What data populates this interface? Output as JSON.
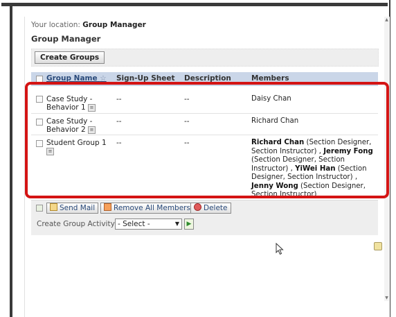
{
  "breadcrumb": {
    "label": "Your location:",
    "current": "Group Manager"
  },
  "page_title": "Group Manager",
  "toolbar": {
    "create_groups_label": "Create Groups"
  },
  "table": {
    "headers": {
      "group_name": "Group Name",
      "signup_sheet": "Sign-Up Sheet",
      "description": "Description",
      "members": "Members"
    },
    "rows": [
      {
        "name_line1": "Case Study -",
        "name_line2": "Behavior 1",
        "signup": "--",
        "description": "--",
        "members_text": "Daisy Chan"
      },
      {
        "name_line1": "Case Study -",
        "name_line2": "Behavior 2",
        "signup": "--",
        "description": "--",
        "members_text": "Richard Chan"
      },
      {
        "name_line1": "Student Group 1",
        "signup": "--",
        "description": "--",
        "members": [
          {
            "name": "Richard Chan",
            "roles": " (Section Designer, Section Instructor) ,"
          },
          {
            "name": "Jeremy Fong",
            "roles": " (Section Designer, Section Instructor) ,"
          },
          {
            "name": "YiWei Han",
            "roles": " (Section Designer, Section Instructor) ,"
          },
          {
            "name": "Jenny Wong",
            "roles": " (Section Designer, Section Instructor)"
          }
        ]
      }
    ]
  },
  "actions": {
    "send_mail": "Send Mail",
    "remove_all_members": "Remove All Members",
    "delete": "Delete",
    "create_group_activity_label": "Create Group Activity:",
    "select_value": "- Select -"
  },
  "colors": {
    "highlight_outline": "#d41414",
    "header_bg": "#cad6e8",
    "toolbar_bg": "#eeeeee"
  }
}
